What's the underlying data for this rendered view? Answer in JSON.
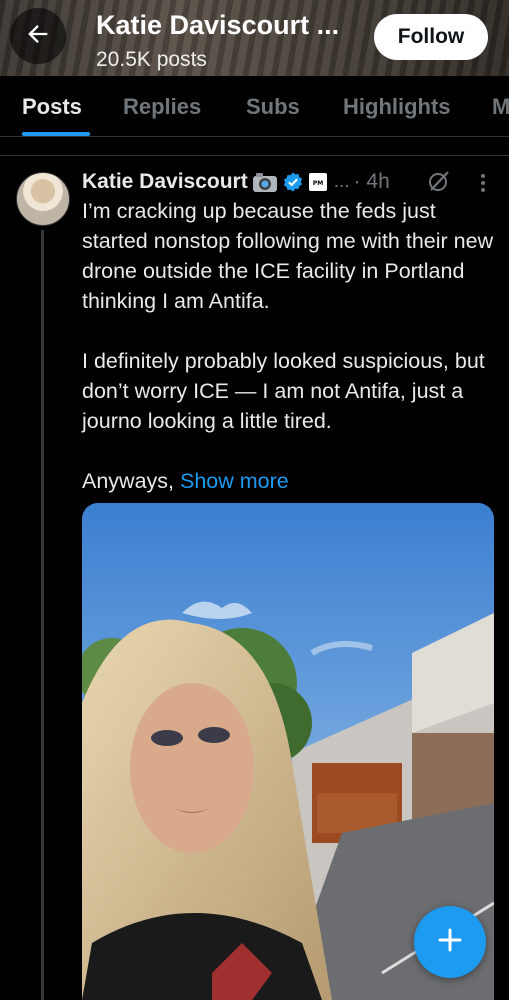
{
  "header": {
    "title": "Katie Daviscourt ...",
    "posts_count": "20.5K posts",
    "follow_label": "Follow"
  },
  "tabs": [
    {
      "label": "Posts",
      "active": true
    },
    {
      "label": "Replies",
      "active": false
    },
    {
      "label": "Subs",
      "active": false
    },
    {
      "label": "Highlights",
      "active": false
    },
    {
      "label": "M",
      "active": false
    }
  ],
  "post": {
    "author": "Katie Daviscourt",
    "handle_truncated": "...",
    "time": "· 4h",
    "paragraphs": [
      "I’m cracking up because the feds just started nonstop following me with their new drone outside the ICE facility in Portland thinking I am Antifa.",
      "I definitely probably looked suspicious, but don’t worry ICE — I am not Antifa, just a journo looking a little tired.",
      "Anyways,"
    ],
    "show_more": "Show more",
    "badges": [
      "camera-emoji-badge",
      "verified-badge-icon",
      "affiliation-badge"
    ],
    "media_alt": "Selfie photo outside a building"
  },
  "icons": {
    "back": "arrow-left-icon",
    "grok": "grok-icon",
    "more": "more-vertical-icon",
    "compose": "plus-icon"
  },
  "colors": {
    "accent": "#1d9bf0",
    "background": "#000000",
    "text": "#e7e9ea",
    "muted": "#71767b"
  }
}
